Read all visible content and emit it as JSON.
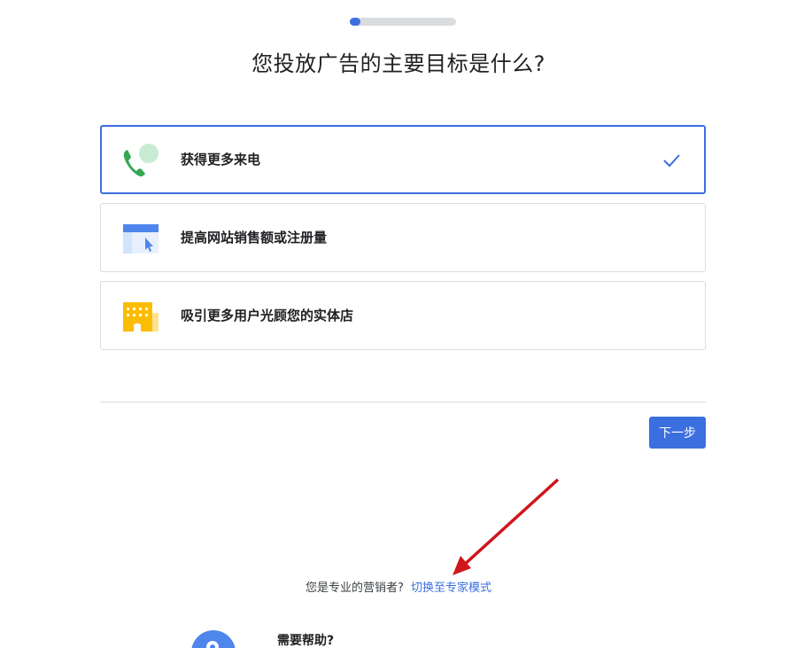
{
  "progress": {
    "fraction": 0.1
  },
  "title": "您投放广告的主要目标是什么?",
  "options": [
    {
      "label": "获得更多来电",
      "icon": "phone-call-icon",
      "selected": true
    },
    {
      "label": "提高网站销售额或注册量",
      "icon": "website-cursor-icon",
      "selected": false
    },
    {
      "label": "吸引更多用户光顾您的实体店",
      "icon": "storefront-icon",
      "selected": false
    }
  ],
  "next_button": "下一步",
  "expert": {
    "question": "您是专业的营销者?",
    "link": "切换至专家模式"
  },
  "help": {
    "title": "需要帮助?"
  },
  "colors": {
    "accent": "#3b6fe0",
    "border": "#dadce0",
    "phone_green": "#34a853",
    "store_yellow": "#fbbc04",
    "annotation_red": "#d0151b"
  }
}
